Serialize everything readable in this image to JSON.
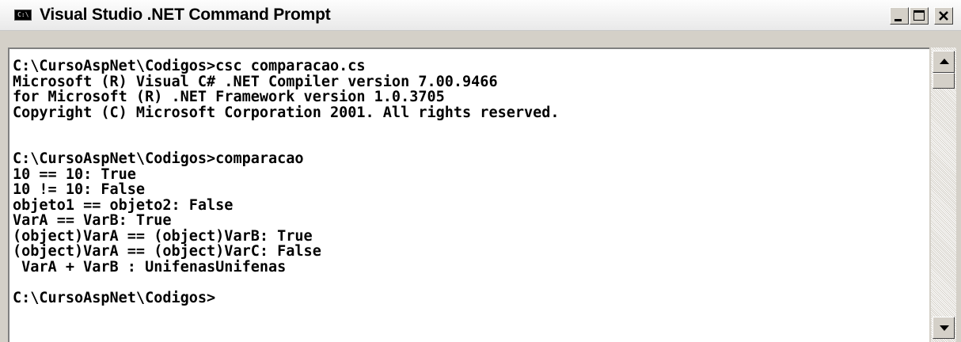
{
  "window": {
    "title": "Visual Studio .NET Command Prompt",
    "icon_label": "C:\\"
  },
  "console": {
    "text": "C:\\CursoAspNet\\Codigos>csc comparacao.cs\nMicrosoft (R) Visual C# .NET Compiler version 7.00.9466\nfor Microsoft (R) .NET Framework version 1.0.3705\nCopyright (C) Microsoft Corporation 2001. All rights reserved.\n\n\nC:\\CursoAspNet\\Codigos>comparacao\n10 == 10: True\n10 != 10: False\nobjeto1 == objeto2: False\nVarA == VarB: True\n(object)VarA == (object)VarB: True\n(object)VarA == (object)VarC: False\n VarA + VarB : UnifenasUnifenas\n\nC:\\CursoAspNet\\Codigos>"
  },
  "icons": {
    "app": "console-icon",
    "minimize": "minimize-icon",
    "maximize": "maximize-icon",
    "close": "close-icon",
    "scroll_up": "arrow-up-icon",
    "scroll_down": "arrow-down-icon"
  },
  "colors": {
    "console_bg": "#ffffff",
    "console_fg": "#000000",
    "chrome": "#d4d0c8"
  }
}
